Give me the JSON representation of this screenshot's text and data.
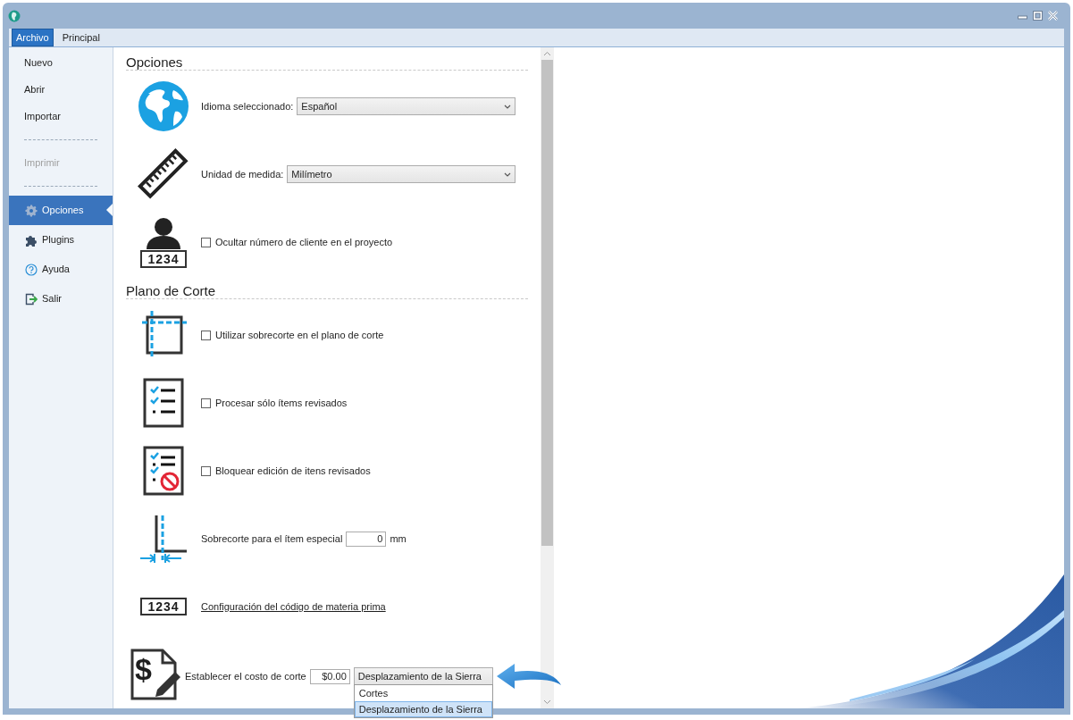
{
  "tabs": [
    {
      "label": "Archivo",
      "selected": true
    },
    {
      "label": "Principal",
      "selected": false
    }
  ],
  "sidebar": {
    "items": [
      {
        "kind": "item",
        "label": "Nuevo",
        "selected": false,
        "disabled": false
      },
      {
        "kind": "item",
        "label": "Abrir",
        "selected": false,
        "disabled": false
      },
      {
        "kind": "item",
        "label": "Importar",
        "selected": false,
        "disabled": false
      },
      {
        "kind": "separator"
      },
      {
        "kind": "item",
        "label": "Imprimir",
        "selected": false,
        "disabled": true
      },
      {
        "kind": "separator"
      },
      {
        "kind": "item",
        "label": "Opciones",
        "selected": true,
        "disabled": false
      },
      {
        "kind": "item",
        "label": "Plugins",
        "selected": false,
        "disabled": false
      },
      {
        "kind": "item",
        "label": "Ayuda",
        "selected": false,
        "disabled": false
      },
      {
        "kind": "item",
        "label": "Salir",
        "selected": false,
        "disabled": false
      }
    ]
  },
  "sections": [
    {
      "title": "Opciones",
      "rows": [
        {
          "kind": "select",
          "label": "Idioma seleccionado:",
          "value": "Español"
        },
        {
          "kind": "select",
          "label": "Unidad de medida:",
          "value": "Milímetro"
        },
        {
          "kind": "checkbox",
          "label": "Ocultar número de cliente en el proyecto",
          "checked": false,
          "badge": "1234"
        }
      ]
    },
    {
      "title": "Plano de Corte",
      "rows": [
        {
          "kind": "checkbox",
          "label": "Utilizar sobrecorte en el plano de corte",
          "checked": false
        },
        {
          "kind": "checkbox",
          "label": "Procesar sólo ítems revisados",
          "checked": false
        },
        {
          "kind": "checkbox",
          "label": "Bloquear edición de itens revisados",
          "checked": false
        },
        {
          "kind": "number",
          "label": "Sobrecorte para el ítem especial",
          "value": "0",
          "unit": "mm"
        },
        {
          "kind": "link",
          "label": "Configuración del código de materia prima",
          "badge": "1234"
        },
        {
          "kind": "cost",
          "label": "Establecer el costo de corte",
          "symbol": "$",
          "value": "$0.00",
          "mode": "Desplazamiento de la Sierra",
          "options": [
            {
              "label": "Cortes",
              "selected": false
            },
            {
              "label": "Desplazamiento de la Sierra",
              "selected": true
            }
          ]
        }
      ]
    }
  ]
}
